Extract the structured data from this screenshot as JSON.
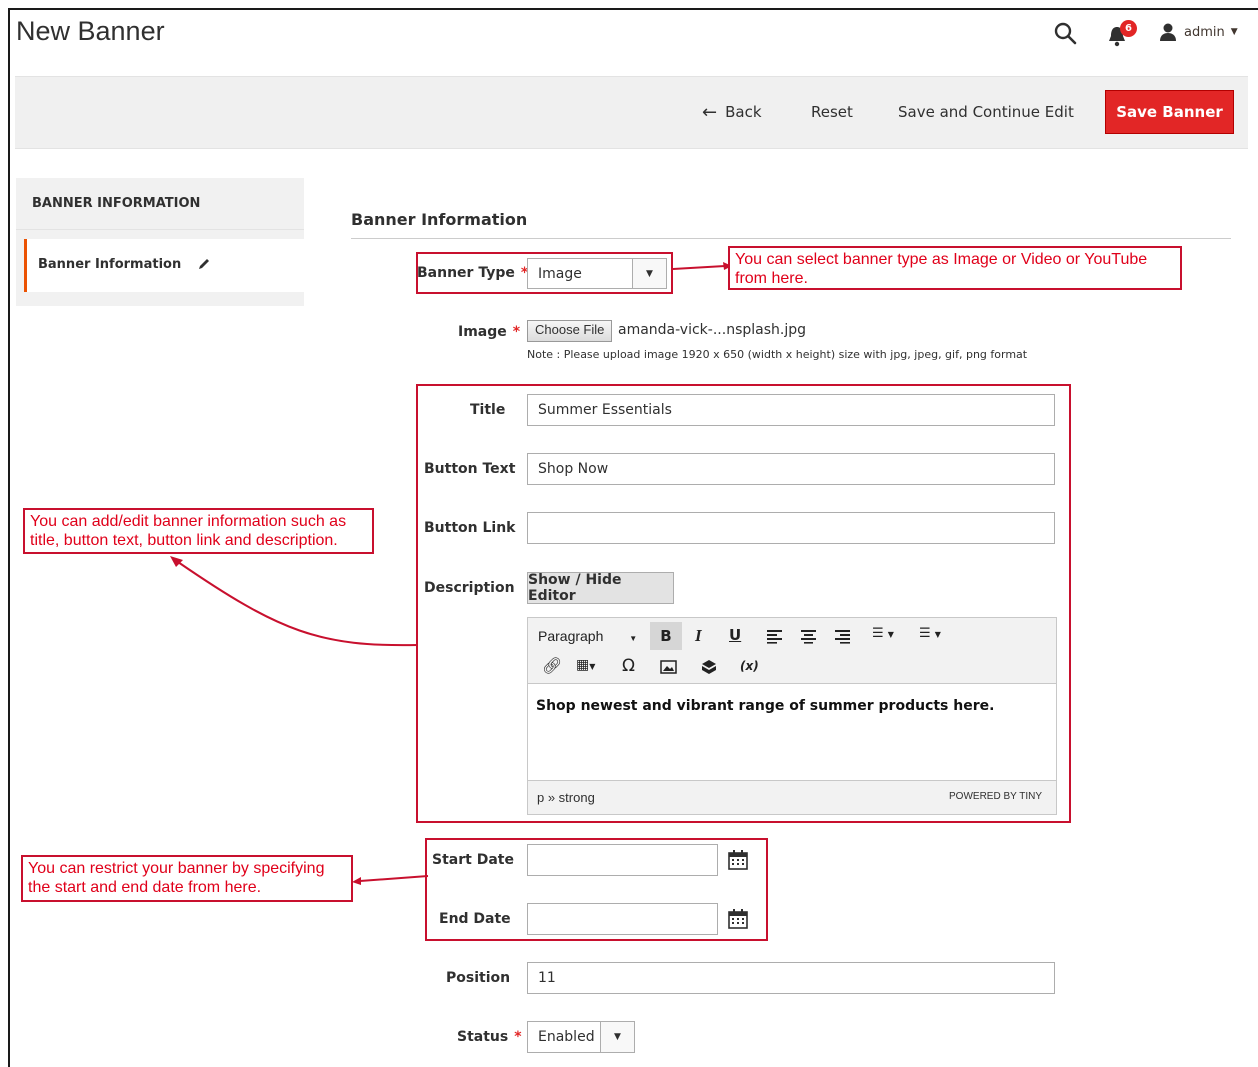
{
  "page": {
    "title": "New Banner"
  },
  "header": {
    "notification_count": "6",
    "user": "admin"
  },
  "actions": {
    "back": "Back",
    "reset": "Reset",
    "save_continue": "Save and Continue Edit",
    "save": "Save Banner"
  },
  "sidebar": {
    "heading": "BANNER INFORMATION",
    "item": "Banner Information"
  },
  "section": {
    "title": "Banner Information"
  },
  "form": {
    "banner_type": {
      "label": "Banner Type",
      "value": "Image"
    },
    "image": {
      "label": "Image",
      "button": "Choose File",
      "filename": "amanda-vick-...nsplash.jpg",
      "note": "Note : Please upload image 1920 x 650 (width x height) size with jpg, jpeg, gif, png format"
    },
    "title": {
      "label": "Title",
      "value": "Summer Essentials"
    },
    "button_text": {
      "label": "Button Text",
      "value": "Shop Now"
    },
    "button_link": {
      "label": "Button Link",
      "value": ""
    },
    "description": {
      "label": "Description",
      "toggle": "Show / Hide Editor"
    },
    "editor": {
      "format": "Paragraph",
      "bold": "B",
      "italic": "I",
      "underline": "U",
      "variable": "(x)",
      "content": "Shop newest and vibrant range of summer products here.",
      "path": "p » strong",
      "powered": "POWERED BY TINY"
    },
    "start_date": {
      "label": "Start Date",
      "value": ""
    },
    "end_date": {
      "label": "End Date",
      "value": ""
    },
    "position": {
      "label": "Position",
      "value": "11"
    },
    "status": {
      "label": "Status",
      "value": "Enabled"
    }
  },
  "annotations": {
    "banner_type": "You can select banner type as Image or Video or YouTube from here.",
    "info": "You can add/edit banner information such as title, button text, button link and description.",
    "dates": "You can restrict your banner by specifying the start and end date from here."
  },
  "colors": {
    "accent": "#e22626",
    "annotation": "#c8102e",
    "sidebar_active": "#eb5202"
  }
}
